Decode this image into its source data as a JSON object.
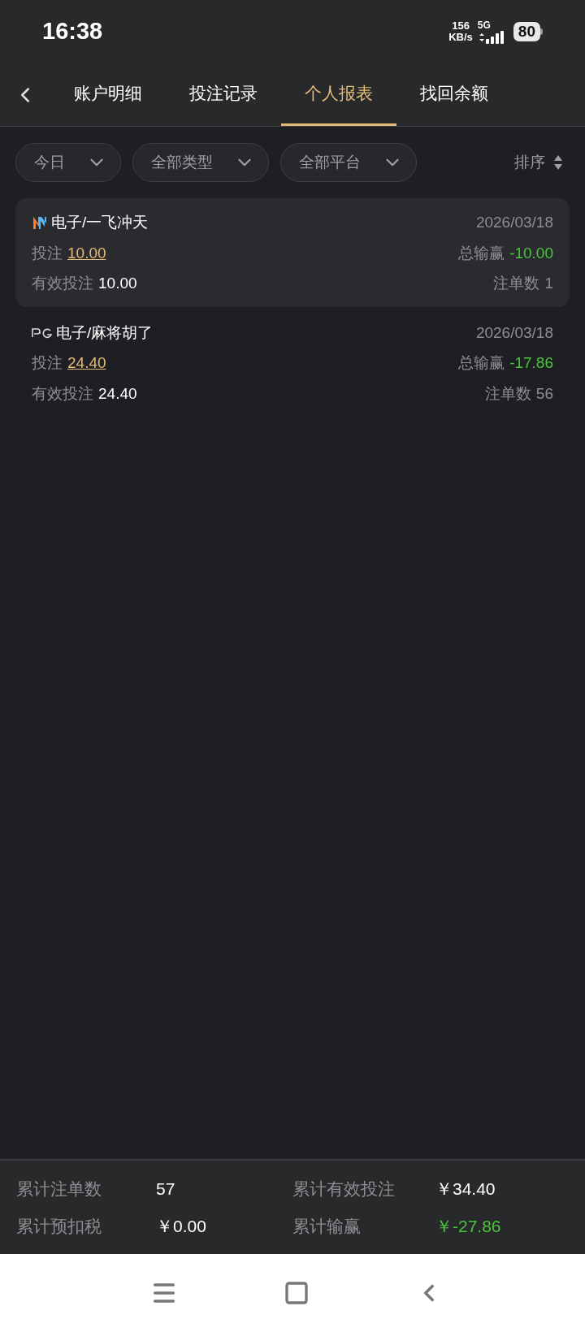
{
  "status_bar": {
    "time": "16:38",
    "speed": "156",
    "speed_unit": "KB/s",
    "network": "5G",
    "battery": "80"
  },
  "tabs": [
    {
      "label": "账户明细",
      "selected": false
    },
    {
      "label": "投注记录",
      "selected": false
    },
    {
      "label": "个人报表",
      "selected": true
    },
    {
      "label": "找回余额",
      "selected": false
    }
  ],
  "filters": [
    {
      "label": "今日"
    },
    {
      "label": "全部类型"
    },
    {
      "label": "全部平台"
    }
  ],
  "sort": {
    "label": "排序"
  },
  "records": [
    {
      "kind": "n",
      "title": "电子/一飞冲天",
      "date": "2026/03/18",
      "bet_label": "投注",
      "bet": "10.00",
      "win_label": "总输赢",
      "win": "-10.00",
      "valid_label": "有效投注",
      "valid": "10.00",
      "count_label": "注单数",
      "count": "1",
      "selected": true
    },
    {
      "kind": "pg",
      "title": "电子/麻将胡了",
      "date": "2026/03/18",
      "bet_label": "投注",
      "bet": "24.40",
      "win_label": "总输赢",
      "win": "-17.86",
      "valid_label": "有效投注",
      "valid": "24.40",
      "count_label": "注单数",
      "count": "56",
      "selected": false
    }
  ],
  "summary": [
    {
      "label": "累计注单数",
      "value": "57",
      "color": "#ffffff"
    },
    {
      "label": "累计有效投注",
      "value": "￥34.40",
      "color": "#ffffff"
    },
    {
      "label": "累计预扣税",
      "value": "￥0.00",
      "color": "#ffffff"
    },
    {
      "label": "累计输赢",
      "value": "￥-27.86",
      "color": "#4cc33f"
    }
  ]
}
